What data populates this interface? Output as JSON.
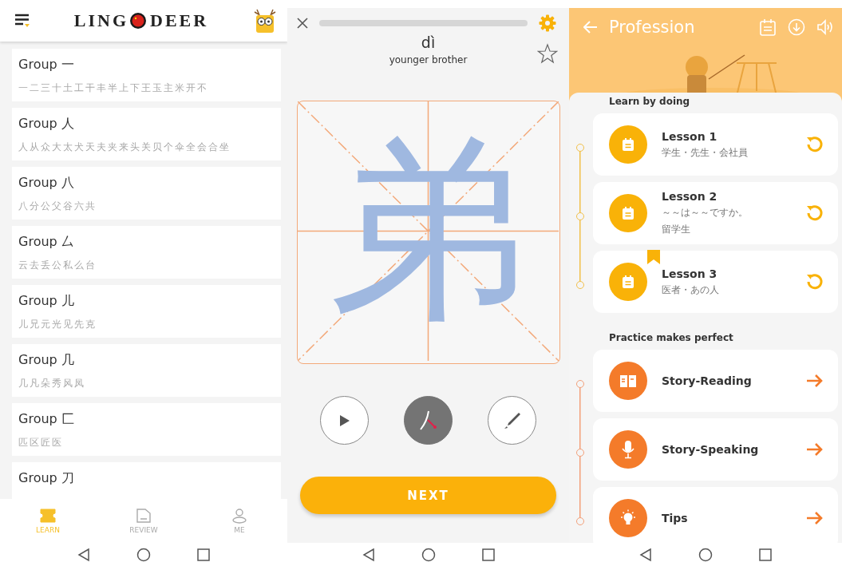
{
  "learn_screen": {
    "header": {
      "logo_left": "LING",
      "logo_right": "DEER"
    },
    "groups": [
      {
        "title": "Group 一",
        "characters": "一二三十土工干丰半上下王玉主米开不"
      },
      {
        "title": "Group 人",
        "characters": "人从众大太犬天夫夹来头关贝个伞全会合坐"
      },
      {
        "title": "Group 八",
        "characters": "八分公父谷六共"
      },
      {
        "title": "Group 厶",
        "characters": "云去丢公私么台"
      },
      {
        "title": "Group 儿",
        "characters": "儿兄元光见先克"
      },
      {
        "title": "Group 几",
        "characters": "几凡朵秀风凤"
      },
      {
        "title": "Group 匚",
        "characters": "匹区匠医"
      },
      {
        "title": "Group 刀"
      }
    ],
    "tabs": [
      {
        "kind": "learn",
        "label": "LEARN",
        "selected": true
      },
      {
        "kind": "review",
        "label": "REVIEW",
        "selected": false
      },
      {
        "kind": "me",
        "label": "ME",
        "selected": false
      }
    ]
  },
  "writing_screen": {
    "progress": {
      "level": 0
    },
    "pinyin": "dì",
    "meaning": "younger brother",
    "starred": false,
    "character": "弟",
    "tools": [
      {
        "kind": "play",
        "selected": false
      },
      {
        "kind": "stroke",
        "selected": true
      },
      {
        "kind": "pencil",
        "selected": false
      }
    ],
    "next_button": "NEXT"
  },
  "lesson_screen": {
    "title": "Profession",
    "sections": [
      {
        "heading": "Learn by doing",
        "items": [
          {
            "kind": "lesson",
            "title": "Lesson 1",
            "subtitle_lines": [
              "学生・先生・会社員"
            ],
            "bookmarked": false
          },
          {
            "kind": "lesson",
            "title": "Lesson 2",
            "subtitle_lines": [
              "～～は～～ですか。",
              "留学生"
            ],
            "bookmarked": false
          },
          {
            "kind": "lesson",
            "title": "Lesson 3",
            "subtitle_lines": [
              "医者・あの人"
            ],
            "bookmarked": true
          }
        ]
      },
      {
        "heading": "Practice makes perfect",
        "items": [
          {
            "kind": "reading",
            "title": "Story-Reading"
          },
          {
            "kind": "speaking",
            "title": "Story-Speaking"
          },
          {
            "kind": "tips",
            "title": "Tips"
          }
        ]
      }
    ]
  }
}
